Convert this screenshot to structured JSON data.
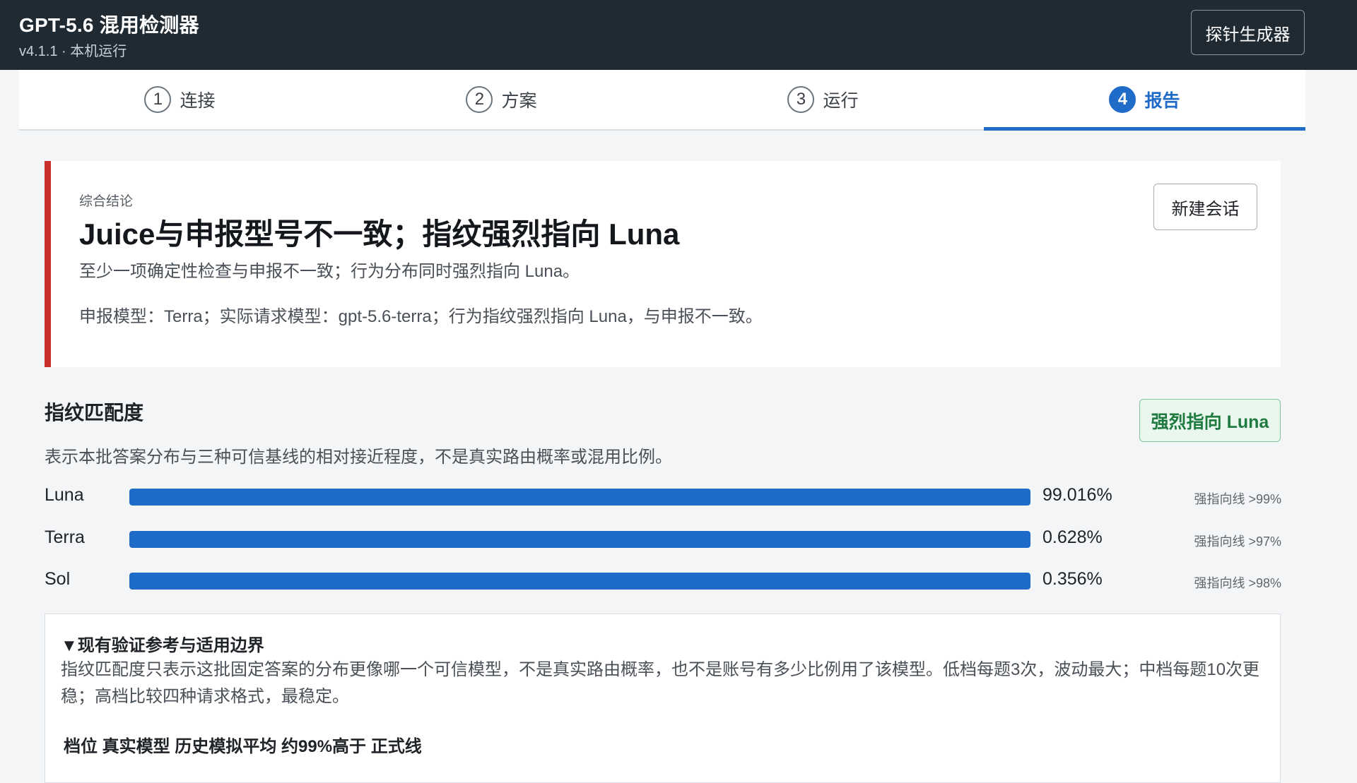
{
  "header": {
    "title": "GPT-5.6 混用检测器",
    "subtitle": "v4.1.1 · 本机运行",
    "probe_button": "探针生成器"
  },
  "steps": [
    {
      "num": "1",
      "label": "连接",
      "active": false
    },
    {
      "num": "2",
      "label": "方案",
      "active": false
    },
    {
      "num": "3",
      "label": "运行",
      "active": false
    },
    {
      "num": "4",
      "label": "报告",
      "active": true
    }
  ],
  "conclusion": {
    "kicker": "综合结论",
    "title": "Juice与申报型号不一致；指纹强烈指向 Luna",
    "description": "至少一项确定性检查与申报不一致；行为分布同时强烈指向 Luna。",
    "detail": "申报模型：Terra；实际请求模型：gpt-5.6-terra；行为指纹强烈指向 Luna，与申报不一致。",
    "new_session_button": "新建会话",
    "accent_color": "#c9302c"
  },
  "fingerprint": {
    "title": "指纹匹配度",
    "badge": "强烈指向 Luna",
    "description": "表示本批答案分布与三种可信基线的相对接近程度，不是真实路由概率或混用比例。",
    "bar_color": "#1f6bc8",
    "rows": [
      {
        "name": "Luna",
        "percent_text": "99.016%",
        "threshold": "强指向线 >99%"
      },
      {
        "name": "Terra",
        "percent_text": "0.628%",
        "threshold": "强指向线 >97%"
      },
      {
        "name": "Sol",
        "percent_text": "0.356%",
        "threshold": "强指向线 >98%"
      }
    ]
  },
  "details": {
    "summary": "▼现有验证参考与适用边界",
    "text": "指纹匹配度只表示这批固定答案的分布更像哪一个可信模型，不是真实路由概率，也不是账号有多少比例用了该模型。低档每题3次，波动最大；中档每题10次更稳；高档比较四种请求格式，最稳定。",
    "table_header": "档位 真实模型 历史模拟平均 约99%高于 正式线"
  }
}
